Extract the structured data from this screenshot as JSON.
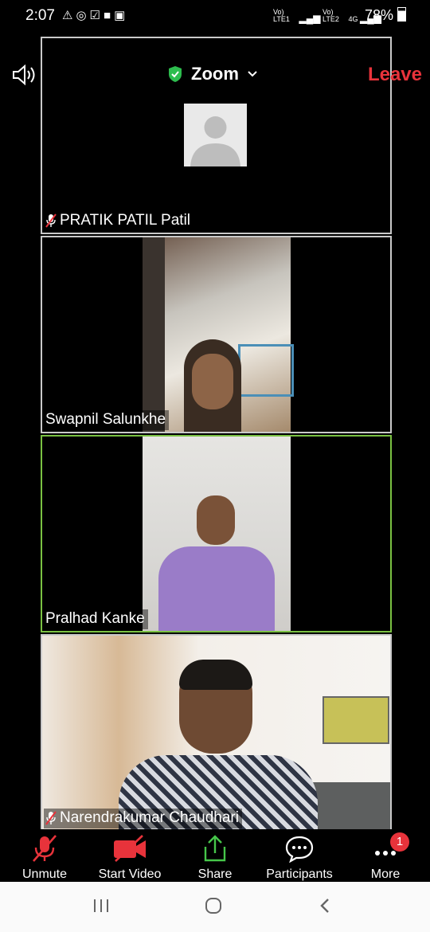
{
  "status_bar": {
    "time": "2:07",
    "notification_icons": [
      "warning-icon",
      "whatsapp-icon",
      "checkbox-icon",
      "video-icon",
      "image-icon"
    ],
    "network_label_1": "Vo) LTE1",
    "network_label_2": "Vo) LTE2",
    "network_type": "4G",
    "battery": "78%"
  },
  "top_bar": {
    "app_title": "Zoom",
    "leave_label": "Leave",
    "leave_color": "#e8333b",
    "secure_color": "#2dbd4e"
  },
  "participants": [
    {
      "name": "PRATIK PATIL Patil",
      "muted": true,
      "video": false
    },
    {
      "name": "Swapnil Salunkhe",
      "muted": false,
      "video": true
    },
    {
      "name": "Pralhad Kanke",
      "muted": false,
      "video": true,
      "active_speaker": true
    },
    {
      "name": "Narendrakumar Chaudhari",
      "muted": true,
      "video": true
    }
  ],
  "toolbar": {
    "unmute_label": "Unmute",
    "start_video_label": "Start Video",
    "share_label": "Share",
    "participants_label": "Participants",
    "more_label": "More",
    "more_badge": "1",
    "alert_color": "#e8333b",
    "share_color": "#46c64a"
  },
  "active_speaker_color": "#7ac142"
}
